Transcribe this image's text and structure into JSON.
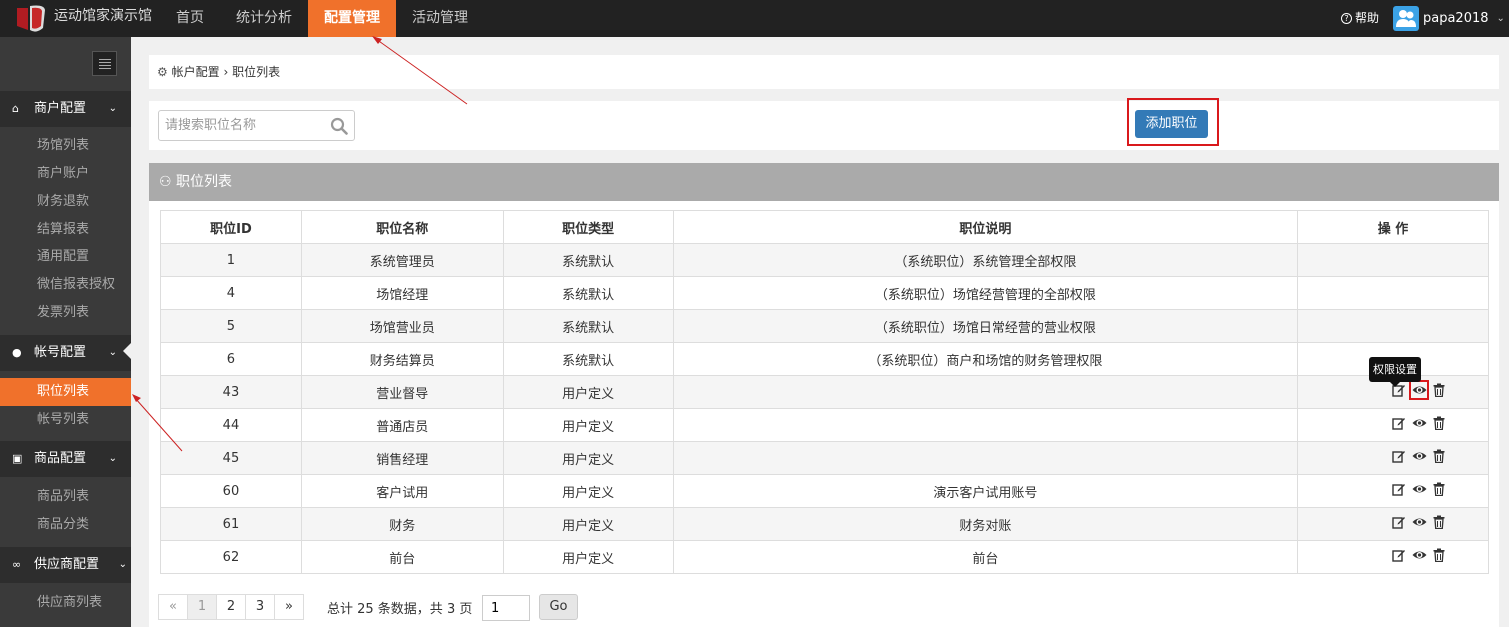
{
  "topbar": {
    "brand": "运动馆家演示馆",
    "nav": [
      "首页",
      "统计分析",
      "配置管理",
      "活动管理"
    ],
    "active_nav": "配置管理",
    "help": "帮助",
    "user": "papa2018",
    "accent": "#f0712b"
  },
  "sidebar": {
    "sections": [
      {
        "label": "商户配置",
        "icon": "home-icon",
        "items": [
          "场馆列表",
          "商户账户",
          "财务退款",
          "结算报表",
          "通用配置",
          "微信报表授权",
          "发票列表"
        ]
      },
      {
        "label": "帐号配置",
        "icon": "user-icon",
        "items": [
          "职位列表",
          "帐号列表"
        ]
      },
      {
        "label": "商品配置",
        "icon": "gift-icon",
        "items": [
          "商品列表",
          "商品分类"
        ]
      },
      {
        "label": "供应商配置",
        "icon": "link-icon",
        "items": [
          "供应商列表"
        ]
      }
    ],
    "active_item": "职位列表"
  },
  "breadcrumb": {
    "parent": "帐户配置",
    "sep": "›",
    "current": "职位列表"
  },
  "toolbar": {
    "search_placeholder": "请搜索职位名称",
    "add_label": "添加职位"
  },
  "panel": {
    "title": "职位列表"
  },
  "table": {
    "headers": [
      "职位ID",
      "职位名称",
      "职位类型",
      "职位说明",
      "操 作"
    ],
    "rows": [
      {
        "id": "1",
        "name": "系统管理员",
        "type": "系统默认",
        "desc": "（系统职位）系统管理全部权限",
        "ops": false
      },
      {
        "id": "4",
        "name": "场馆经理",
        "type": "系统默认",
        "desc": "（系统职位）场馆经营管理的全部权限",
        "ops": false
      },
      {
        "id": "5",
        "name": "场馆营业员",
        "type": "系统默认",
        "desc": "（系统职位）场馆日常经营的营业权限",
        "ops": false
      },
      {
        "id": "6",
        "name": "财务结算员",
        "type": "系统默认",
        "desc": "（系统职位）商户和场馆的财务管理权限",
        "ops": false
      },
      {
        "id": "43",
        "name": "营业督导",
        "type": "用户定义",
        "desc": "",
        "ops": true
      },
      {
        "id": "44",
        "name": "普通店员",
        "type": "用户定义",
        "desc": "",
        "ops": true
      },
      {
        "id": "45",
        "name": "销售经理",
        "type": "用户定义",
        "desc": "",
        "ops": true
      },
      {
        "id": "60",
        "name": "客户试用",
        "type": "用户定义",
        "desc": "演示客户试用账号",
        "ops": true
      },
      {
        "id": "61",
        "name": "财务",
        "type": "用户定义",
        "desc": "财务对账",
        "ops": true
      },
      {
        "id": "62",
        "name": "前台",
        "type": "用户定义",
        "desc": "前台",
        "ops": true
      }
    ],
    "tooltip": "权限设置"
  },
  "pagination": {
    "prev": "«",
    "pages": [
      "1",
      "2",
      "3"
    ],
    "next": "»",
    "total_text": "总计 25 条数据，共 3 页",
    "goto_value": "1",
    "go_label": "Go"
  }
}
